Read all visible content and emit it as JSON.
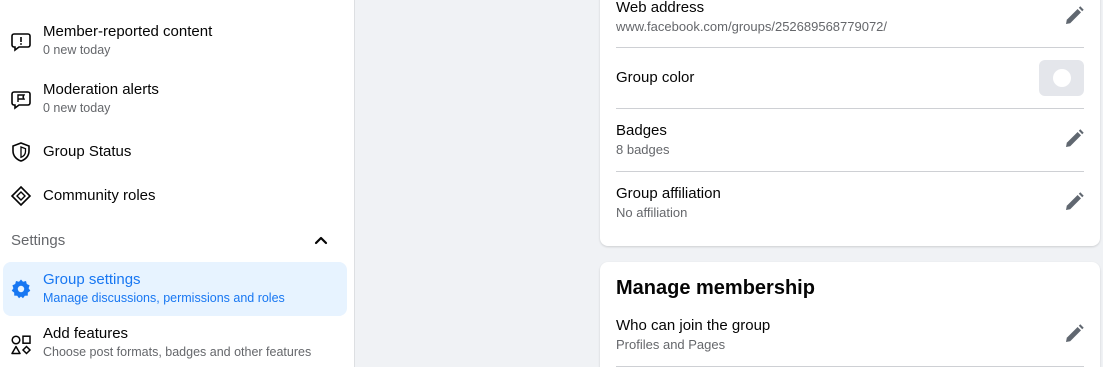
{
  "sidebar": {
    "items": [
      {
        "title": "Member-reported content",
        "sub": "0 new today",
        "icon": "exclamation-bubble-icon"
      },
      {
        "title": "Moderation alerts",
        "sub": "0 new today",
        "icon": "flag-bubble-icon"
      },
      {
        "title": "Group Status",
        "icon": "shield-icon"
      },
      {
        "title": "Community roles",
        "icon": "diamond-icon"
      }
    ],
    "settings_label": "Settings",
    "settings_items": [
      {
        "title": "Group settings",
        "sub": "Manage discussions, permissions and roles",
        "icon": "gear-icon",
        "active": true
      },
      {
        "title": "Add features",
        "sub": "Choose post formats, badges and other features",
        "icon": "shapes-icon"
      }
    ]
  },
  "customize_card": {
    "rows": [
      {
        "title": "Web address",
        "sub": "www.facebook.com/groups/252689568779072/"
      },
      {
        "title": "Group color"
      },
      {
        "title": "Badges",
        "sub": "8 badges"
      },
      {
        "title": "Group affiliation",
        "sub": "No affiliation"
      }
    ]
  },
  "membership_card": {
    "heading": "Manage membership",
    "rows": [
      {
        "title": "Who can join the group",
        "sub": "Profiles and Pages"
      }
    ]
  },
  "colors": {
    "accent": "#1877f2",
    "active_bg": "#e7f3ff",
    "secondary_text": "#65676b",
    "page_bg": "#f0f2f5"
  }
}
